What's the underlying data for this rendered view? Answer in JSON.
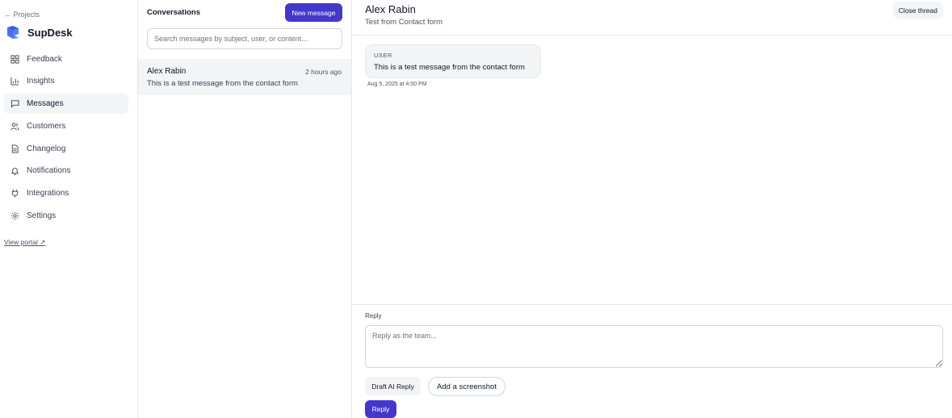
{
  "sidebar": {
    "back_label": "← Projects",
    "brand": "SupDesk",
    "items": [
      {
        "label": "Feedback",
        "icon": "grid-icon"
      },
      {
        "label": "Insights",
        "icon": "bar-chart-icon"
      },
      {
        "label": "Messages",
        "icon": "message-icon",
        "active": true
      },
      {
        "label": "Customers",
        "icon": "users-icon"
      },
      {
        "label": "Changelog",
        "icon": "document-icon"
      },
      {
        "label": "Notifications",
        "icon": "bell-icon"
      },
      {
        "label": "Integrations",
        "icon": "plug-icon"
      },
      {
        "label": "Settings",
        "icon": "gear-icon"
      }
    ],
    "view_portal": "View portal ↗"
  },
  "conversations": {
    "title": "Conversations",
    "new_message_label": "New message",
    "search_placeholder": "Search messages by subject, user, or content...",
    "items": [
      {
        "name": "Alex Rabin",
        "time": "2 hours ago",
        "preview": "This is a test message from the contact form"
      }
    ]
  },
  "thread": {
    "name": "Alex Rabin",
    "subject": "Test from Contact form",
    "close_label": "Close thread",
    "messages": [
      {
        "role": "USER",
        "text": "This is a test message from the contact form",
        "time": "Aug 5, 2025 at 4:00 PM"
      }
    ],
    "reply": {
      "label": "Reply",
      "placeholder": "Reply as the team...",
      "draft_ai_label": "Draft AI Reply",
      "screenshot_label": "Add a screenshot",
      "submit_label": "Reply"
    }
  },
  "colors": {
    "accent": "#4338ca",
    "active_bg": "#f3f4f6",
    "border": "#e5e7eb",
    "brand_logo": "#3b5bdb"
  }
}
